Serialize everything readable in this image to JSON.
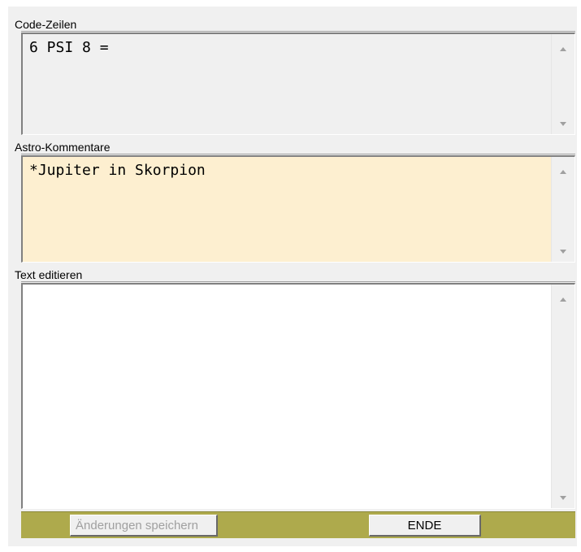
{
  "sections": {
    "code": {
      "label": "Code-Zeilen",
      "text": "6 PSI 8 =",
      "background": "#f0f0f0"
    },
    "astro": {
      "label": "Astro-Kommentare",
      "text": "*Jupiter in Skorpion",
      "background": "#fdefd0"
    },
    "edit": {
      "label": "Text editieren",
      "text": "",
      "background": "#ffffff"
    }
  },
  "toolbar": {
    "save_label": "Änderungen speichern",
    "save_enabled": false,
    "end_label": "ENDE",
    "background": "#aeaa4c"
  },
  "icons": {
    "scroll_up": "scroll-up-arrow-icon",
    "scroll_down": "scroll-down-arrow-icon"
  }
}
